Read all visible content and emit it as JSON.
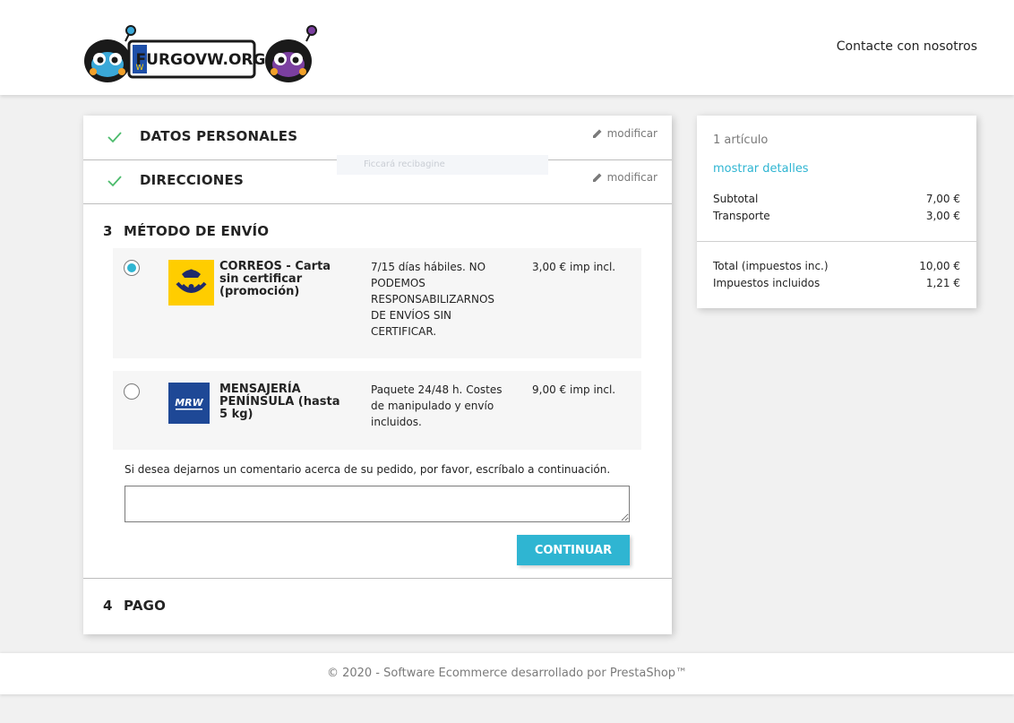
{
  "header": {
    "logo_text": "FURGOVW.ORG",
    "contact_label": "Contacte con nosotros"
  },
  "checkout": {
    "steps": [
      {
        "title": "DATOS PERSONALES",
        "status": "done",
        "edit_label": "modificar"
      },
      {
        "title": "DIRECCIONES",
        "status": "done",
        "edit_label": "modificar"
      },
      {
        "number": "3",
        "title": "MÉTODO DE ENVÍO",
        "status": "current"
      },
      {
        "number": "4",
        "title": "PAGO",
        "status": "pending"
      }
    ],
    "ghost_text": "Ficcará recibagine",
    "carriers": [
      {
        "name": "CORREOS - Carta sin certificar (promoción)",
        "delay": "7/15 días hábiles. NO PODEMOS RESPONSABILIZARNOS DE ENVÍOS SIN CERTIFICAR.",
        "price": "3,00 € imp incl.",
        "selected": true,
        "logo_color": "#ffcd00"
      },
      {
        "name": "MENSAJERÍA PENÍNSULA (hasta 5 kg)",
        "delay": "Paquete 24/48 h. Costes de manipulado y envío incluidos.",
        "price": "9,00 € imp incl.",
        "selected": false,
        "logo_color": "#1e4896",
        "logo_text": "MRW"
      }
    ],
    "comment_label": "Si desea dejarnos un comentario acerca de su pedido, por favor, escríbalo a continuación.",
    "continue_label": "CONTINUAR"
  },
  "summary": {
    "items_count": "1 artículo",
    "details_link": "mostrar detalles",
    "subtotal_label": "Subtotal",
    "subtotal_value": "7,00 €",
    "shipping_label": "Transporte",
    "shipping_value": "3,00 €",
    "total_label": "Total (impuestos inc.)",
    "total_value": "10,00 €",
    "taxes_label": "Impuestos incluidos",
    "taxes_value": "1,21 €",
    "link_color": "#2fb5d2"
  },
  "footer": {
    "text": "© 2020 - Software Ecommerce desarrollado por PrestaShop™"
  }
}
